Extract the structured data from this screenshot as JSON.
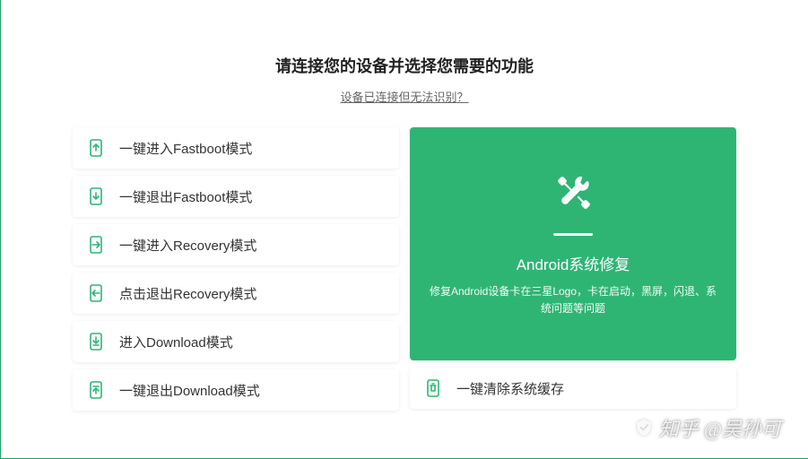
{
  "header": {
    "title": "请连接您的设备并选择您需要的功能",
    "subtitle": "设备已连接但无法识别？"
  },
  "left_items": [
    {
      "label": "一键进入Fastboot模式",
      "icon": "phone-arrow-up"
    },
    {
      "label": "一键退出Fastboot模式",
      "icon": "phone-arrow-down"
    },
    {
      "label": "一键进入Recovery模式",
      "icon": "phone-arrow-in"
    },
    {
      "label": "点击退出Recovery模式",
      "icon": "phone-arrow-out"
    },
    {
      "label": "进入Download模式",
      "icon": "phone-download"
    },
    {
      "label": "一键退出Download模式",
      "icon": "phone-exit-download"
    }
  ],
  "featured": {
    "title": "Android系统修复",
    "desc": "修复Android设备卡在三星Logo，卡在启动，黑屏，闪退、系统问题等问题"
  },
  "right_items": [
    {
      "label": "一键清除系统缓存",
      "icon": "phone-trash"
    }
  ],
  "watermark": "@吴孙可",
  "colors": {
    "accent": "#2eb574"
  }
}
